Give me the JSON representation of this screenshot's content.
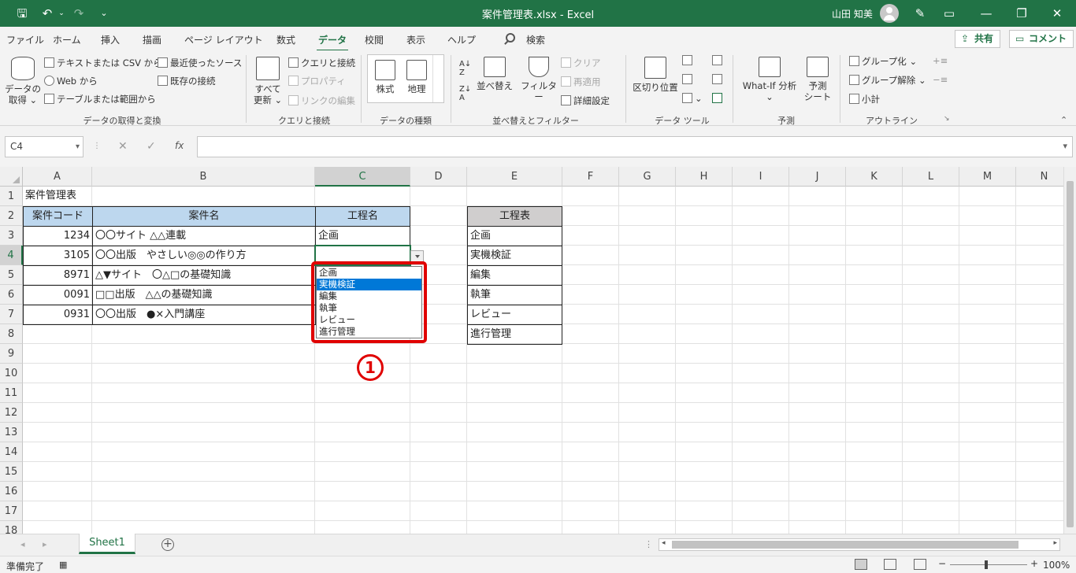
{
  "titlebar": {
    "title": "案件管理表.xlsx  -  Excel",
    "user": "山田 知美"
  },
  "menu": {
    "tabs": [
      "ファイル",
      "ホーム",
      "挿入",
      "描画",
      "ページ レイアウト",
      "数式",
      "データ",
      "校閲",
      "表示",
      "ヘルプ"
    ],
    "active_tab": "データ",
    "search": "検索",
    "share": "共有",
    "comment": "コメント"
  },
  "ribbon": {
    "get_data": "データの\n取得 ⌄",
    "from_text_csv": "テキストまたは CSV から",
    "from_web": "Web から",
    "from_table": "テーブルまたは範囲から",
    "recent_sources": "最近使ったソース",
    "existing_connections": "既存の接続",
    "group_get": "データの取得と変換",
    "refresh_all": "すべて\n更新 ⌄",
    "queries_connections": "クエリと接続",
    "properties": "プロパティ",
    "edit_links": "リンクの編集",
    "group_queries": "クエリと接続",
    "stocks": "株式",
    "geography": "地理",
    "group_datatypes": "データの種類",
    "sort": "並べ替え",
    "filter": "フィルター",
    "clear": "クリア",
    "reapply": "再適用",
    "advanced": "詳細設定",
    "group_sort": "並べ替えとフィルター",
    "text_to_columns": "区切り位置",
    "group_tools": "データ ツール",
    "whatif": "What-If 分析\n⌄",
    "forecast_sheet": "予測\nシート",
    "group_forecast": "予測",
    "group_items": "グループ化",
    "ungroup": "グループ解除",
    "subtotal": "小計",
    "group_outline": "アウトライン"
  },
  "formula": {
    "namebox": "C4",
    "cancel": "✕",
    "enter": "✓",
    "fx": "fx",
    "value": ""
  },
  "columns": [
    "A",
    "B",
    "C",
    "D",
    "E",
    "F",
    "G",
    "H",
    "I",
    "J",
    "K",
    "L",
    "M",
    "N"
  ],
  "rows": [
    "1",
    "2",
    "3",
    "4",
    "5",
    "6",
    "7",
    "8",
    "9",
    "10",
    "11",
    "12",
    "13",
    "14",
    "15",
    "16",
    "17",
    "18"
  ],
  "sheet": {
    "A1": "案件管理表",
    "A2": "案件コード",
    "B2": "案件名",
    "C2": "工程名",
    "E2": "工程表",
    "A3": "1234",
    "B3": "〇〇サイト △△連載",
    "C3": "企画",
    "E3": "企画",
    "A4": "3105",
    "B4": "〇〇出版　やさしい◎◎の作り方",
    "E4": "実機検証",
    "A5": "8971",
    "B5": "△▼サイト　〇△□の基礎知識",
    "E5": "編集",
    "A6": "0091",
    "B6": "□□出版　△△の基礎知識",
    "E6": "執筆",
    "A7": "0931",
    "B7": "〇〇出版　●×入門講座",
    "E7": "レビュー",
    "E8": "進行管理"
  },
  "dropdown": {
    "options": [
      "企画",
      "実機検証",
      "編集",
      "執筆",
      "レビュー",
      "進行管理"
    ],
    "highlighted_index": 1
  },
  "marker": "1",
  "sheettab": "Sheet1",
  "status": {
    "ready": "準備完了",
    "zoom": "100%"
  },
  "colors": {
    "excel_green": "#217346",
    "header_blue": "#bdd7ee",
    "header_gray": "#d0cece",
    "highlight_red": "#e00000",
    "selection_blue": "#0078d7"
  }
}
